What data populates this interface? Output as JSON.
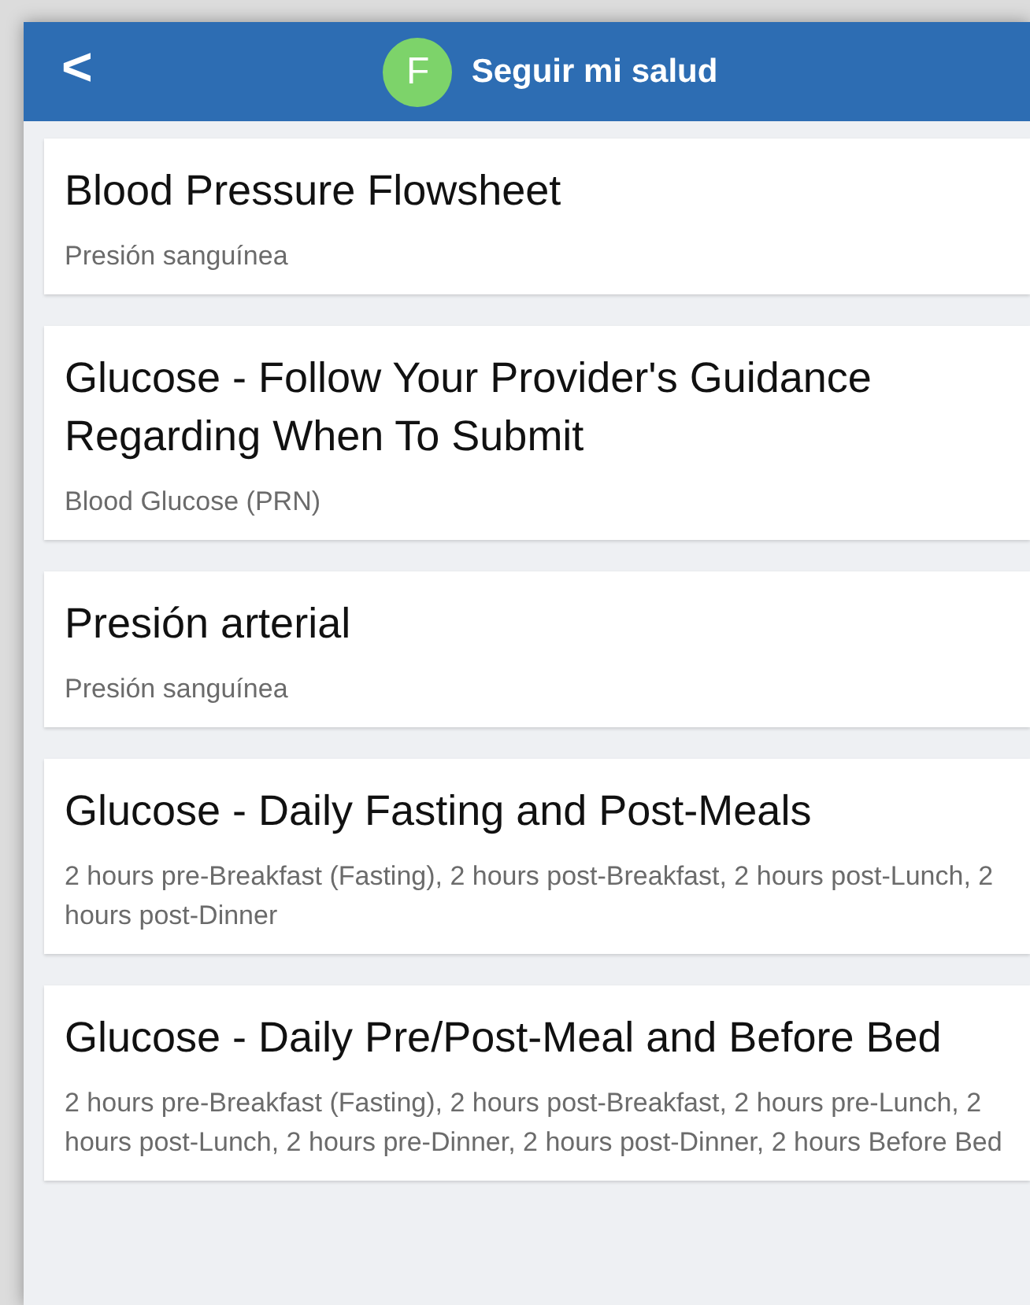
{
  "header": {
    "back": "<",
    "avatar": "F",
    "title": "Seguir mi salud"
  },
  "items": [
    {
      "title": "Blood Pressure Flowsheet",
      "subtitle": "Presión sanguínea"
    },
    {
      "title": "Glucose - Follow Your Provider's Guidance Regarding When To Submit",
      "subtitle": "Blood Glucose (PRN)"
    },
    {
      "title": "Presión arterial",
      "subtitle": "Presión sanguínea"
    },
    {
      "title": "Glucose - Daily Fasting and Post-Meals",
      "subtitle": "2 hours pre-Breakfast (Fasting), 2 hours post-Breakfast, 2 hours post-Lunch, 2 hours post-Dinner"
    },
    {
      "title": "Glucose - Daily Pre/Post-Meal and Before Bed",
      "subtitle": "2 hours pre-Breakfast (Fasting), 2 hours post-Breakfast, 2 hours pre-Lunch, 2 hours post-Lunch, 2 hours pre-Dinner, 2 hours post-Dinner, 2 hours Before Bed"
    }
  ]
}
